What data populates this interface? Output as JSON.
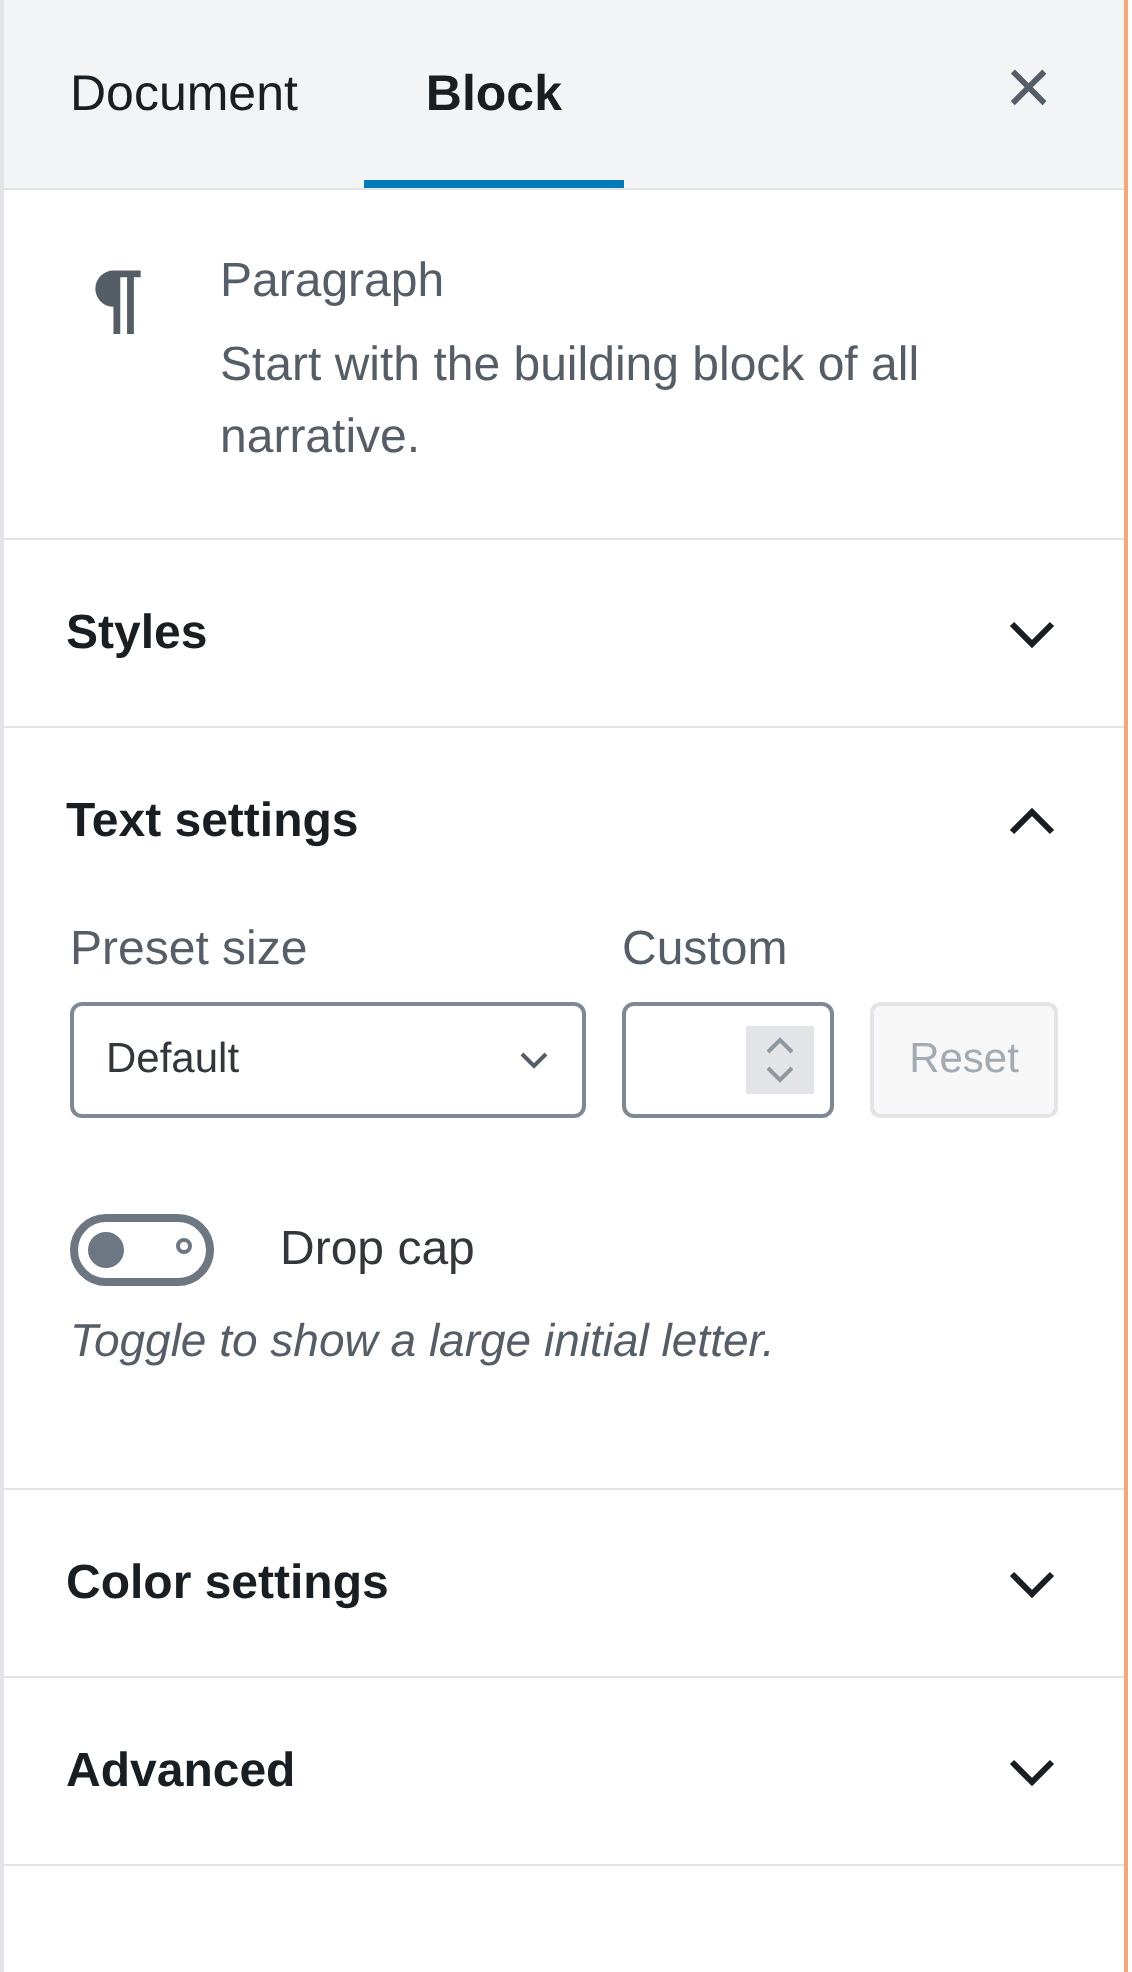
{
  "tabs": [
    {
      "label": "Document",
      "selected": false
    },
    {
      "label": "Block",
      "selected": true
    }
  ],
  "close_button": {
    "label": "×"
  },
  "block_card": {
    "title": "Paragraph",
    "description": "Start with the building block of all narrative."
  },
  "panels": [
    {
      "title": "Styles",
      "expanded": false
    },
    {
      "title": "Text settings",
      "expanded": true,
      "controls": {
        "preset_size_label": "Preset size",
        "preset_size_value": "Default",
        "custom_label": "Custom",
        "reset_button": {
          "label": "Reset",
          "disabled": true
        },
        "drop_cap": {
          "label": "Drop cap",
          "on": false,
          "help": "Toggle to show a large initial letter."
        }
      }
    },
    {
      "title": "Color settings",
      "expanded": false
    },
    {
      "title": "Advanced",
      "expanded": false
    }
  ]
}
